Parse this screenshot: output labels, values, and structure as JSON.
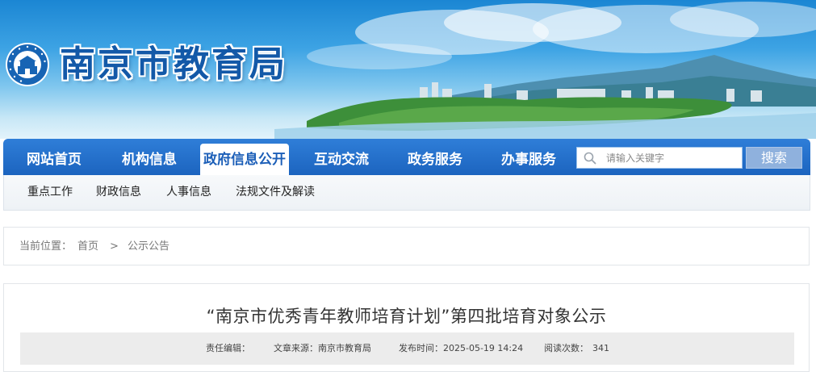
{
  "banner": {
    "site_title": "南京市教育局",
    "emblem_text": "南京市教育局 NANJING EDUCATION",
    "emblem_icon": "city-gate-emblem",
    "colors": {
      "sky_top": "#1b86d3",
      "title": "#1359a8"
    }
  },
  "nav": {
    "items": [
      {
        "label": "网站首页"
      },
      {
        "label": "机构信息"
      },
      {
        "label": "政府信息公开",
        "active": true
      },
      {
        "label": "互动交流"
      },
      {
        "label": "政务服务"
      },
      {
        "label": "办事服务"
      }
    ],
    "search_placeholder": "请输入关键字",
    "search_icon": "search-icon",
    "search_button": "搜索",
    "colors": {
      "bar": "#1c64bf",
      "active_text": "#1c5fb8"
    }
  },
  "subnav": {
    "items": [
      {
        "label": "重点工作"
      },
      {
        "label": "财政信息"
      },
      {
        "label": "人事信息"
      },
      {
        "label": "法规文件及解读"
      }
    ]
  },
  "breadcrumb": {
    "prefix": "当前位置：",
    "items": [
      "首页",
      "公示公告"
    ],
    "separator": ">"
  },
  "article": {
    "title": "“南京市优秀青年教师培育计划”第四批培育对象公示",
    "meta": {
      "editor_label": "责任编辑：",
      "editor_value": "",
      "source": "文章来源：南京市教育局",
      "publish_time": "发布时间：2025-05-19 14:24",
      "read_count_label": "阅读次数：",
      "read_count": "341"
    }
  }
}
